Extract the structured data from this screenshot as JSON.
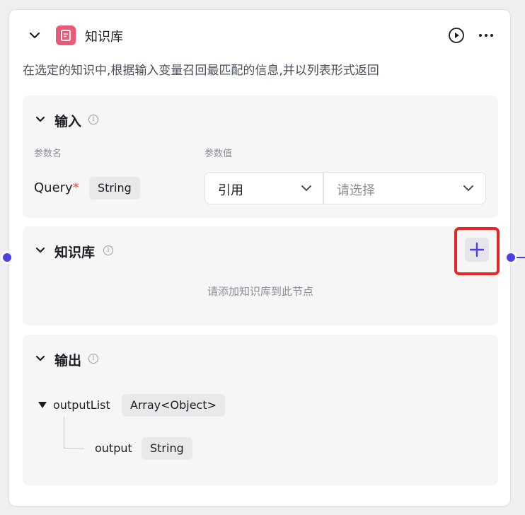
{
  "node": {
    "title": "知识库",
    "description": "在选定的知识中,根据输入变量召回最匹配的信息,并以列表形式返回",
    "icon": "knowledge-base-icon",
    "accent_color": "#e85a78"
  },
  "input_section": {
    "title": "输入",
    "param_name_header": "参数名",
    "param_value_header": "参数值",
    "param": {
      "name": "Query",
      "required_mark": "*",
      "type": "String",
      "source": "引用",
      "value_placeholder": "请选择"
    }
  },
  "knowledge_section": {
    "title": "知识库",
    "empty_text": "请添加知识库到此节点",
    "add_button": "+"
  },
  "output_section": {
    "title": "输出",
    "items": [
      {
        "name": "outputList",
        "type": "Array<Object>"
      },
      {
        "name": "output",
        "type": "String"
      }
    ]
  },
  "colors": {
    "port": "#4e40e5",
    "highlight": "#e82525"
  }
}
